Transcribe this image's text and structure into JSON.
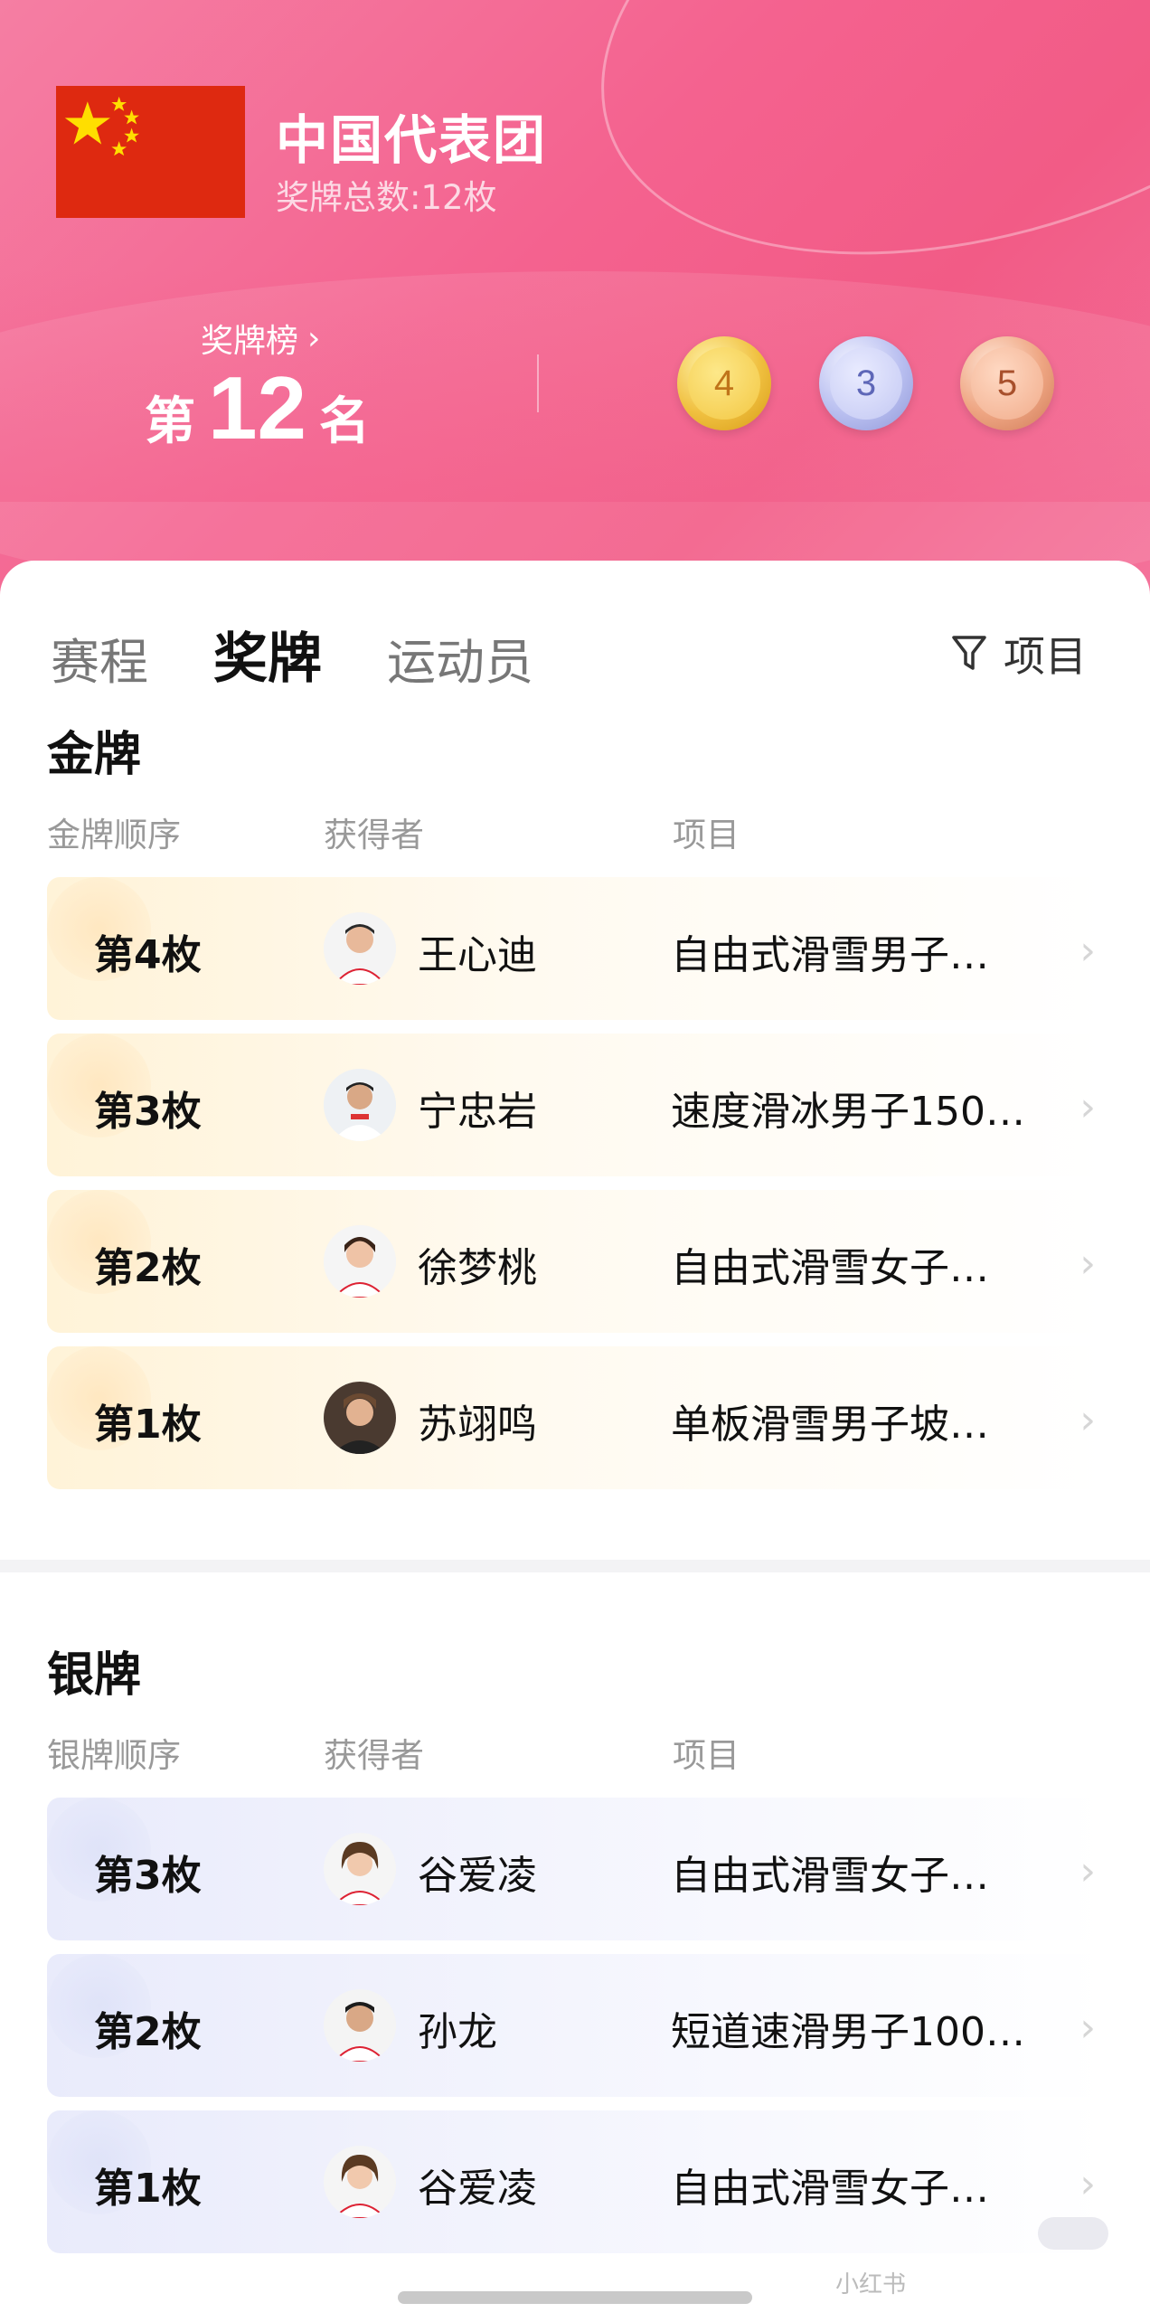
{
  "header": {
    "delegation_name": "中国代表团",
    "medal_total": "奖牌总数:12枚",
    "rank_link": "奖牌榜",
    "rank_prefix": "第",
    "rank_number": "12",
    "rank_suffix": "名",
    "medals": {
      "gold": "4",
      "silver": "3",
      "bronze": "5"
    }
  },
  "tabs": [
    {
      "label": "赛程",
      "active": false
    },
    {
      "label": "奖牌",
      "active": true
    },
    {
      "label": "运动员",
      "active": false
    }
  ],
  "filter_label": "项目",
  "gold_section": {
    "title": "金牌",
    "columns": [
      "金牌顺序",
      "获得者",
      "项目"
    ],
    "rows": [
      {
        "order": "第4枚",
        "winner": "王心迪",
        "event": "自由式滑雪男子…"
      },
      {
        "order": "第3枚",
        "winner": "宁忠岩",
        "event": "速度滑冰男子150…"
      },
      {
        "order": "第2枚",
        "winner": "徐梦桃",
        "event": "自由式滑雪女子…"
      },
      {
        "order": "第1枚",
        "winner": "苏翊鸣",
        "event": "单板滑雪男子坡…"
      }
    ]
  },
  "silver_section": {
    "title": "银牌",
    "columns": [
      "银牌顺序",
      "获得者",
      "项目"
    ],
    "rows": [
      {
        "order": "第3枚",
        "winner": "谷爱凌",
        "event": "自由式滑雪女子…"
      },
      {
        "order": "第2枚",
        "winner": "孙龙",
        "event": "短道速滑男子100…"
      },
      {
        "order": "第1枚",
        "winner": "谷爱凌",
        "event": "自由式滑雪女子…"
      }
    ]
  },
  "watermark": "小红书",
  "colors": {
    "accent": "#f4628f",
    "gold_row": "#fff3d8",
    "silver_row": "#e9ebfb",
    "flag_red": "#de2910",
    "flag_star": "#ffde00"
  }
}
